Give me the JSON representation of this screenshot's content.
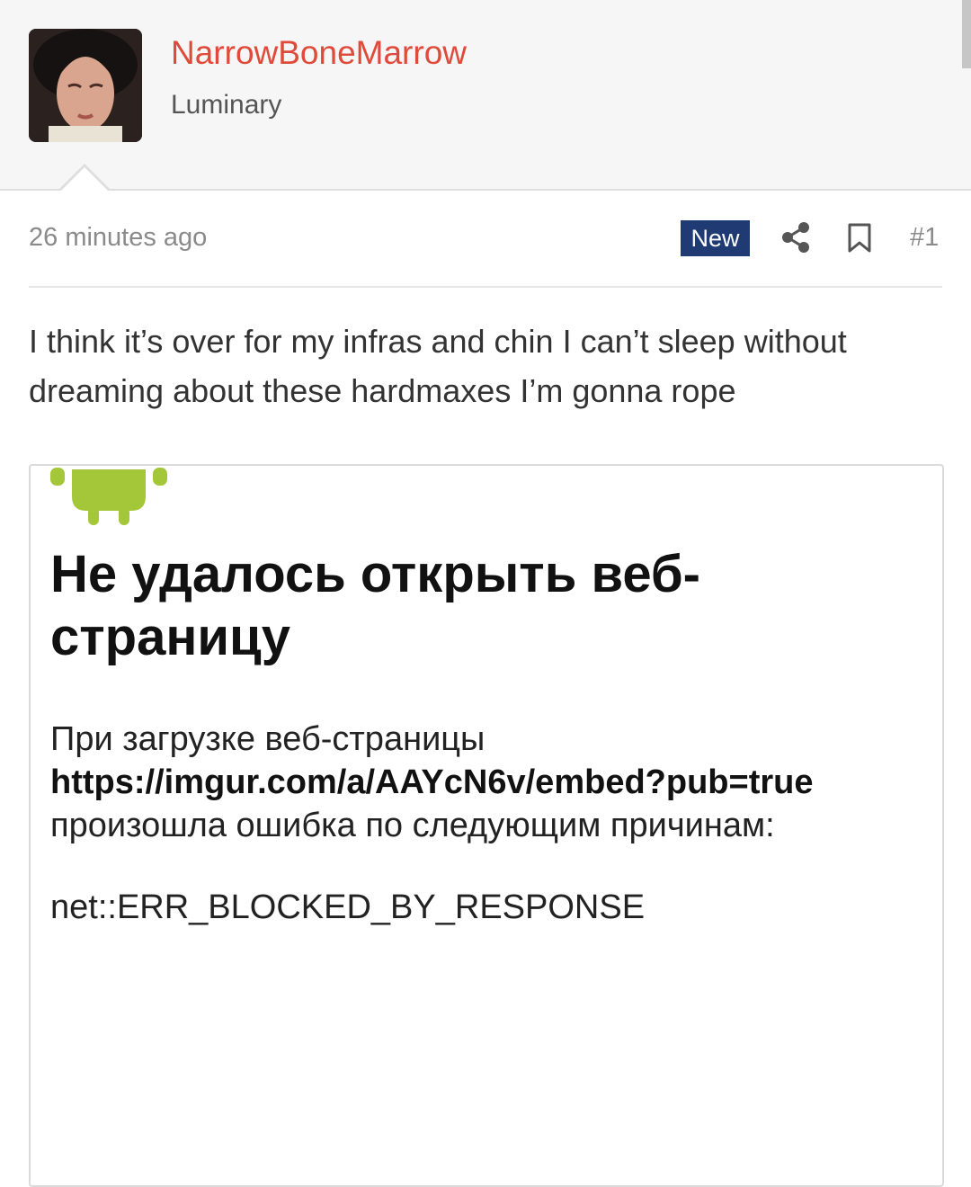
{
  "author": {
    "username": "NarrowBoneMarrow",
    "title": "Luminary"
  },
  "post": {
    "timestamp": "26 minutes ago",
    "badge": "New",
    "number": "#1",
    "text": "I think it’s over for my infras and chin I can’t sleep without dreaming about these hardmaxes I’m gonna rope"
  },
  "embed": {
    "error_title": "Не удалось открыть веб-страницу",
    "message_before": "При загрузке веб-страницы",
    "url": "https://imgur.com/a/AAYcN6v/embed?pub=true",
    "message_after": "произошла ошибка по следующим причинам:",
    "error_code": "net::ERR_BLOCKED_BY_RESPONSE"
  },
  "colors": {
    "username": "#e04a3a",
    "badge_bg": "#203a74",
    "android_green": "#a4c639"
  },
  "icons": [
    "share-icon",
    "bookmark-icon",
    "android-icon"
  ]
}
